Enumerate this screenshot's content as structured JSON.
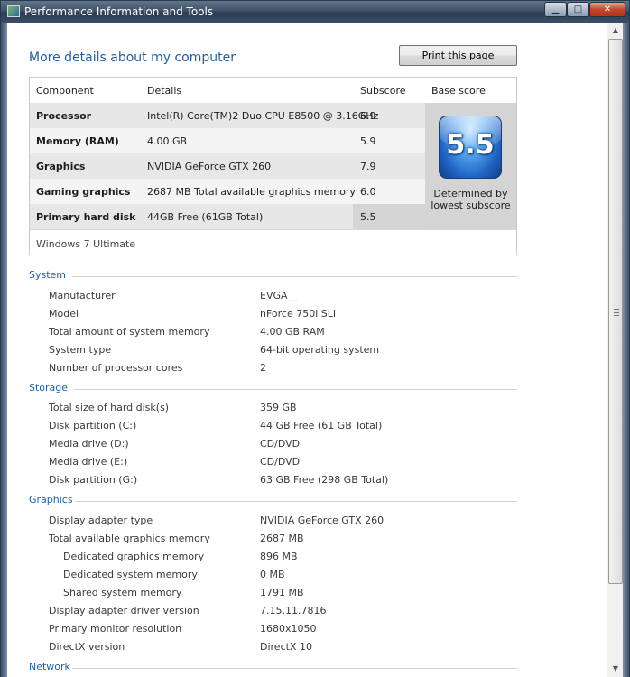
{
  "window": {
    "title": "Performance Information and Tools",
    "controls": {
      "minimize": "▁",
      "maximize": "□",
      "close": "✕"
    }
  },
  "page": {
    "heading": "More details about my computer",
    "print_button": "Print this page"
  },
  "score_table": {
    "headers": {
      "component": "Component",
      "details": "Details",
      "subscore": "Subscore",
      "base_score": "Base score"
    },
    "rows": [
      {
        "component": "Processor",
        "details": "Intel(R) Core(TM)2 Duo CPU E8500 @ 3.16GHz",
        "subscore": "6.9"
      },
      {
        "component": "Memory (RAM)",
        "details": "4.00 GB",
        "subscore": "5.9"
      },
      {
        "component": "Graphics",
        "details": "NVIDIA GeForce GTX 260",
        "subscore": "7.9"
      },
      {
        "component": "Gaming graphics",
        "details": "2687 MB Total available graphics memory",
        "subscore": "6.0"
      },
      {
        "component": "Primary hard disk",
        "details": "44GB Free (61GB Total)",
        "subscore": "5.5"
      }
    ],
    "base_score": "5.5",
    "base_score_note_line1": "Determined by",
    "base_score_note_line2": "lowest subscore",
    "os": "Windows 7 Ultimate"
  },
  "sections": {
    "system": {
      "title": "System",
      "items": [
        {
          "label": "Manufacturer",
          "value": "EVGA__"
        },
        {
          "label": "Model",
          "value": "nForce 750i SLI"
        },
        {
          "label": "Total amount of system memory",
          "value": "4.00 GB RAM"
        },
        {
          "label": "System type",
          "value": "64-bit operating system"
        },
        {
          "label": "Number of processor cores",
          "value": "2"
        }
      ]
    },
    "storage": {
      "title": "Storage",
      "items": [
        {
          "label": "Total size of hard disk(s)",
          "value": "359 GB"
        },
        {
          "label": "Disk partition (C:)",
          "value": "44 GB Free (61 GB Total)"
        },
        {
          "label": "Media drive (D:)",
          "value": "CD/DVD"
        },
        {
          "label": "Media drive (E:)",
          "value": "CD/DVD"
        },
        {
          "label": "Disk partition (G:)",
          "value": "63 GB Free (298 GB Total)"
        }
      ]
    },
    "graphics": {
      "title": "Graphics",
      "items": [
        {
          "label": "Display adapter type",
          "value": "NVIDIA GeForce GTX 260"
        },
        {
          "label": "Total available graphics memory",
          "value": "2687 MB"
        },
        {
          "label": "Dedicated graphics memory",
          "value": "896 MB"
        },
        {
          "label": "Dedicated system memory",
          "value": "0 MB"
        },
        {
          "label": "Shared system memory",
          "value": "1791 MB"
        },
        {
          "label": "Display adapter driver version",
          "value": "7.15.11.7816"
        },
        {
          "label": "Primary monitor resolution",
          "value": "1680x1050"
        },
        {
          "label": "DirectX version",
          "value": "DirectX 10"
        }
      ]
    },
    "network": {
      "title": "Network"
    }
  },
  "colors": {
    "accent_blue": "#1e5fa0",
    "badge_blue": "#1f64c4"
  }
}
